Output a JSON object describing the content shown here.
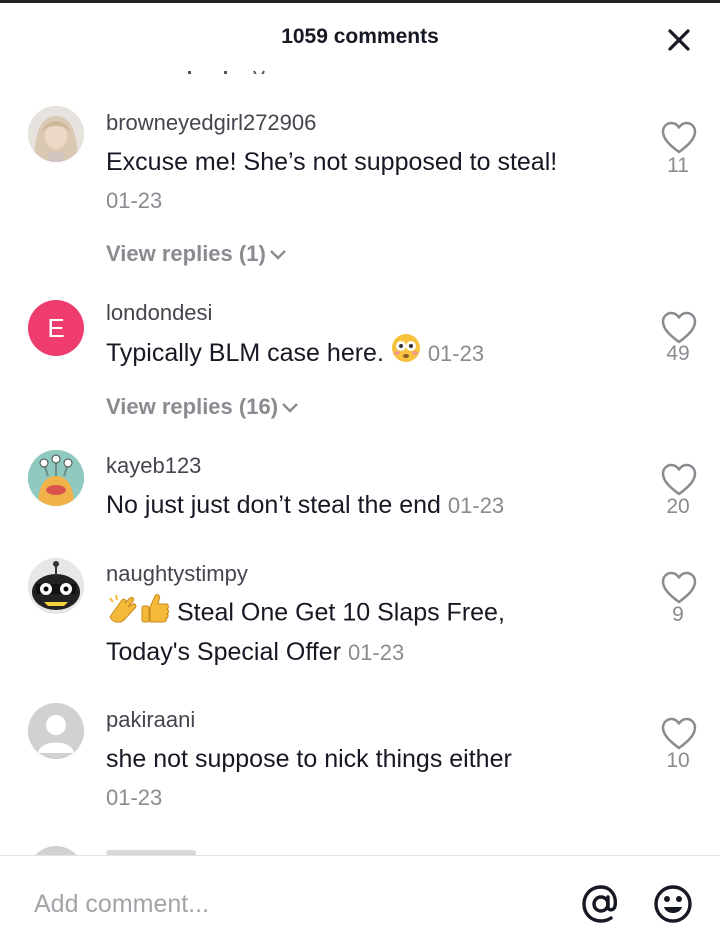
{
  "header": {
    "title": "1059 comments"
  },
  "comments": [
    {
      "username": "browneyedgirl272906",
      "text": "Excuse me! She’s not supposed to steal!",
      "date": "01-23",
      "likes": "11",
      "view_replies": "View replies (1)"
    },
    {
      "username": "londondesi",
      "avatar_letter": "E",
      "text": "Typically BLM case here.",
      "date": "01-23",
      "likes": "49",
      "view_replies": "View replies (16)"
    },
    {
      "username": "kayeb123",
      "text": "No just just don’t steal the end",
      "date": "01-23",
      "likes": "20"
    },
    {
      "username": "naughtystimpy",
      "text_line1": "Steal One Get 10 Slaps Free,",
      "text_line2": "Today's Special Offer",
      "date": "01-23",
      "likes": "9"
    },
    {
      "username": "pakiraani",
      "text": "she not suppose to nick things either",
      "date": "01-23",
      "likes": "10"
    }
  ],
  "composer": {
    "placeholder": "Add comment..."
  },
  "colors": {
    "avatar_letter_bg": "#ee3d6e",
    "muted_text": "#8a8b91",
    "text": "#161823"
  }
}
